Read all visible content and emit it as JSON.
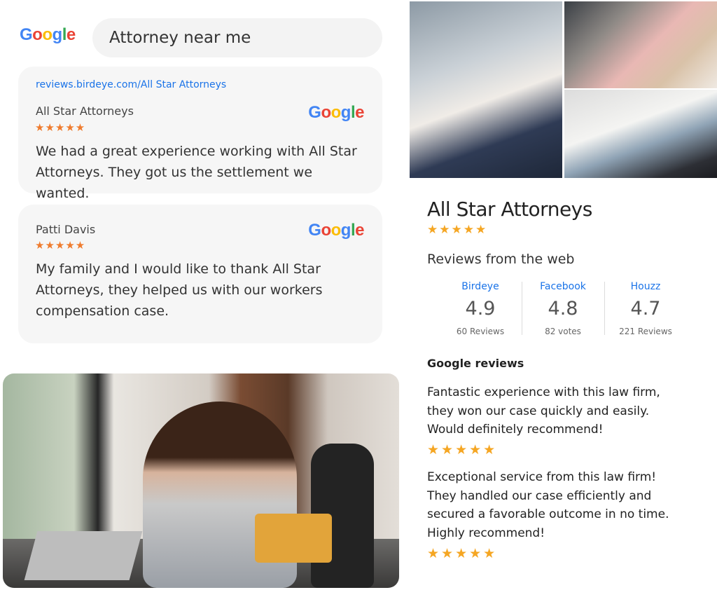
{
  "search": {
    "logo": [
      "G",
      "o",
      "o",
      "g",
      "l",
      "e"
    ],
    "query": "Attorney near me"
  },
  "cards": [
    {
      "url": "reviews.birdeye.com/All Star Attorneys",
      "name": "All Star Attorneys",
      "source_logo": [
        "G",
        "o",
        "o",
        "g",
        "l",
        "e"
      ],
      "stars": "★★★★★",
      "text": "We had a great experience working with All Star Attorneys. They got us the settlement we wanted."
    },
    {
      "name": "Patti Davis",
      "source_logo": [
        "G",
        "o",
        "o",
        "g",
        "l",
        "e"
      ],
      "stars": "★★★★★",
      "text": "My family and I would like to thank All Star Attorneys, they helped us with our workers compensation case."
    }
  ],
  "listing": {
    "title": "All Star Attorneys",
    "stars": "★★★★★",
    "web_heading": "Reviews from the web",
    "sources": [
      {
        "name": "Birdeye",
        "score": "4.9",
        "count": "60 Reviews"
      },
      {
        "name": "Facebook",
        "score": "4.8",
        "count": "82 votes"
      },
      {
        "name": "Houzz",
        "score": "4.7",
        "count": "221 Reviews"
      }
    ],
    "google_heading": "Google reviews",
    "google_reviews": [
      {
        "text": "Fantastic experience with this law firm, they won our case quickly and easily. Would definitely recommend!",
        "stars": "★★★★★"
      },
      {
        "text": "Exceptional service from this law firm! They handled our case efficiently and secured a favorable outcome in no time.",
        "text2": "Highly recommend!",
        "stars": "★★★★★"
      }
    ]
  },
  "colors": {
    "google_blue": "#4285F4",
    "google_red": "#EA4335",
    "google_yellow": "#FBBC05",
    "google_green": "#34A853",
    "link_blue": "#1a73e8",
    "card_star_orange": "#ef7b2d",
    "rating_star_gold": "#f5a623"
  }
}
